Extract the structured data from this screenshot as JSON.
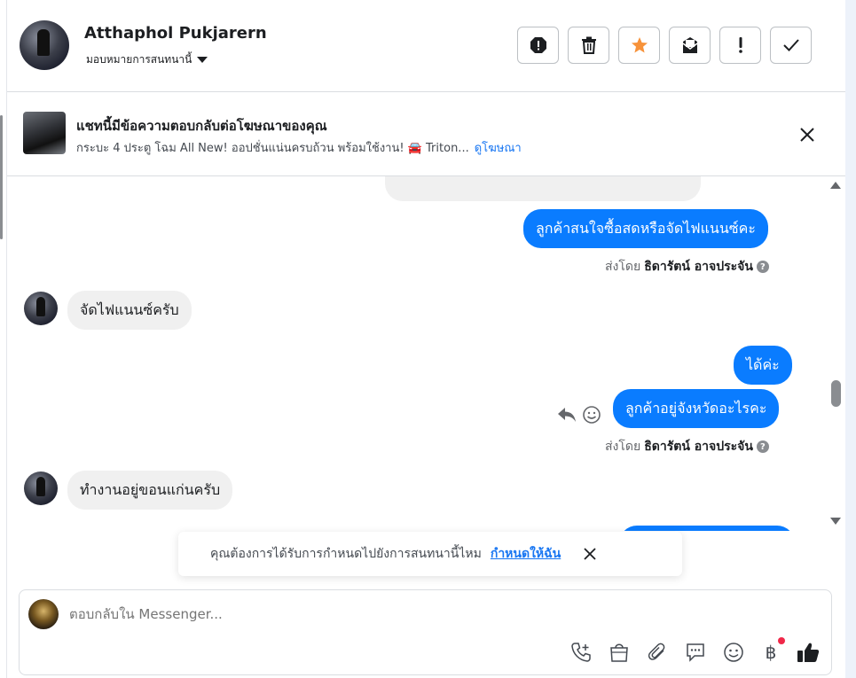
{
  "header": {
    "contact_name": "Atthaphol Pukjarern",
    "assign_label": "มอบหมายการสนทนานี้",
    "toolbar": [
      "spam-icon",
      "trash-icon",
      "star-icon",
      "mark-unread-icon",
      "exclamation-icon",
      "check-icon"
    ],
    "star_color": "#f7923a"
  },
  "ad_banner": {
    "title": "แชทนี้มีข้อความตอบกลับต่อโฆษณาของคุณ",
    "subtitle": "กระบะ 4 ประตู โฉม All New! ออปชั่นแน่นครบถ้วน พร้อมใช้งาน! 🚘 Triton...",
    "link": "ดูโฆษณา"
  },
  "messages": {
    "out_1": "ลูกค้าสนใจซื้อสดหรือจัดไฟแนนซ์คะ",
    "sent_by_1": {
      "prefix": "ส่งโดย",
      "name": "ธิดารัตน์ อาจประจัน"
    },
    "in_1": "จัดไฟแนนซ์ครับ",
    "out_2": "ได้ค่ะ",
    "out_3": "ลูกค้าอยู่จังหวัดอะไรคะ",
    "sent_by_2": {
      "prefix": "ส่งโดย",
      "name": "ธิดารัตน์ อาจประจัน"
    },
    "in_2": "ทำงานอยู่ขอนแก่นครับ",
    "outgoing_color": "#0a7cff",
    "incoming_color": "#f0f0f0"
  },
  "toast": {
    "text": "คุณต้องการได้รับการกำหนดไปยังการสนทนานี้ไหม",
    "link": "กำหนดให้ฉัน"
  },
  "composer": {
    "placeholder": "ตอบกลับใน Messenger...",
    "icons": [
      "call-plus-icon",
      "shopping-bag-icon",
      "paperclip-icon",
      "chat-bubble-icon",
      "emoji-icon",
      "baht-icon",
      "thumbs-up-icon"
    ]
  }
}
